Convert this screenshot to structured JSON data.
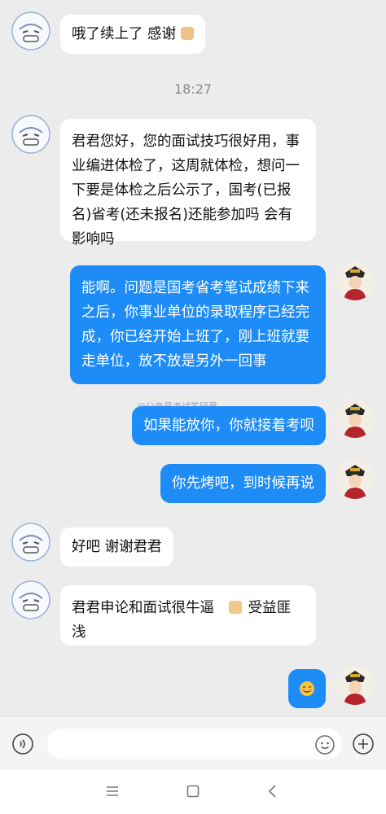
{
  "messages": {
    "m1": "哦了续上了  感谢",
    "time": "18:27",
    "m2": "君君您好，您的面试技巧很好用，事业编进体检了，这周就体检，想问一下要是体检之后公示了，国考(已报名)省考(还未报名)还能参加吗 会有影响吗",
    "m3": "能啊。问题是国考省考笔试成绩下来之后，你事业单位的录取程序已经完成，你已经开始上班了，刚上班就要走单位，放不放是另外一回事",
    "m4": "如果能放你，你就接着考呗",
    "m5": "你先烤吧，到时候再说",
    "m6": "好吧  谢谢君君",
    "m7a": "君君申论和面试很牛逼",
    "m7b": "受益匪浅"
  },
  "watermark": "@公务员考试答疑君",
  "icons": {
    "voice": "voice-icon",
    "emoji": "emoji-icon",
    "add": "plus-icon",
    "menu": "menu-icon",
    "home": "home-icon",
    "back": "back-icon"
  },
  "colors": {
    "outgoing_bubble": "#1e8cf7",
    "incoming_bubble": "#ffffff",
    "background": "#ececec"
  }
}
